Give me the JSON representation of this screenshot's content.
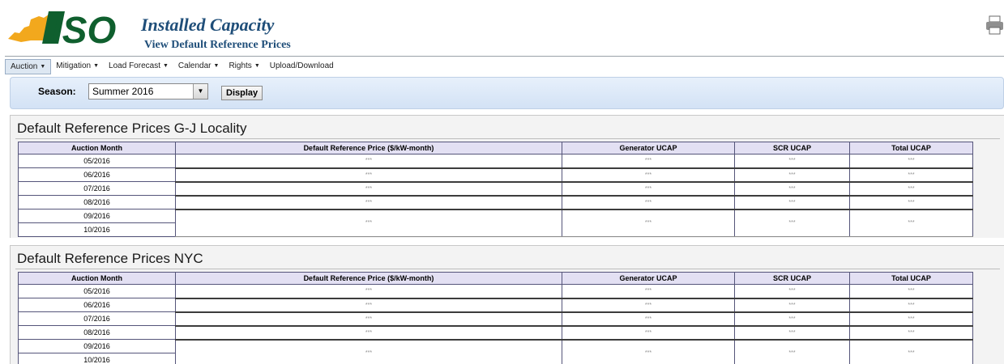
{
  "header": {
    "logo_text": "ISO",
    "title": "Installed Capacity",
    "subtitle": "View Default Reference Prices"
  },
  "nav": [
    {
      "label": "Auction",
      "has_dropdown": true,
      "active": true
    },
    {
      "label": "Mitigation",
      "has_dropdown": true
    },
    {
      "label": "Load Forecast",
      "has_dropdown": true
    },
    {
      "label": "Calendar",
      "has_dropdown": true
    },
    {
      "label": "Rights",
      "has_dropdown": true
    },
    {
      "label": "Upload/Download",
      "has_dropdown": false
    }
  ],
  "season": {
    "label": "Season:",
    "value": "Summer 2016",
    "display_button": "Display"
  },
  "columns": [
    "Auction Month",
    "Default Reference Price ($/kW-month)",
    "Generator UCAP",
    "SCR UCAP",
    "Total UCAP"
  ],
  "panels": [
    {
      "title": "Default Reference Prices G-J Locality",
      "months": [
        "05/2016",
        "06/2016",
        "07/2016",
        "08/2016",
        "09/2016",
        "10/2016"
      ],
      "values": [
        [
          "***",
          "***",
          "***",
          "***"
        ],
        [
          "***",
          "***",
          "***",
          "***"
        ],
        [
          "***",
          "***",
          "***",
          "***"
        ],
        [
          "***",
          "***",
          "***",
          "***"
        ],
        [
          "***",
          "***",
          "***",
          "***"
        ]
      ]
    },
    {
      "title": "Default Reference Prices NYC",
      "months": [
        "05/2016",
        "06/2016",
        "07/2016",
        "08/2016",
        "09/2016",
        "10/2016"
      ],
      "values": [
        [
          "***",
          "***",
          "***",
          "***"
        ],
        [
          "***",
          "***",
          "***",
          "***"
        ],
        [
          "***",
          "***",
          "***",
          "***"
        ],
        [
          "***",
          "***",
          "***",
          "***"
        ],
        [
          "***",
          "***",
          "***",
          "***"
        ]
      ]
    }
  ]
}
